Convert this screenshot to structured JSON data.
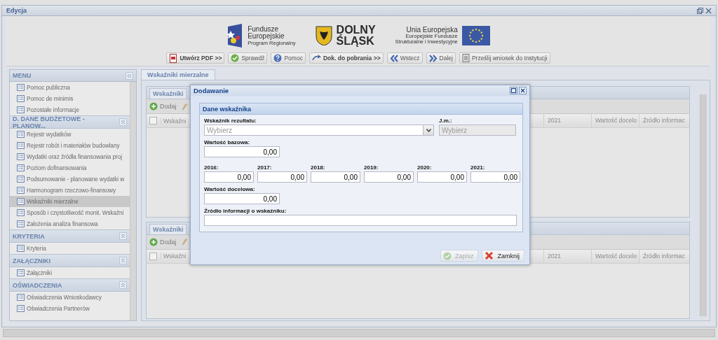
{
  "window": {
    "title": "Edycja"
  },
  "header": {
    "logos": [
      {
        "kind": "fe",
        "lines": [
          "Fundusze",
          "Europejskie",
          "Program Regionalny"
        ]
      },
      {
        "kind": "ds",
        "lines": [
          "DOLNY",
          "ŚLĄSK"
        ]
      },
      {
        "kind": "ue",
        "lines": [
          "Unia Europejska",
          "Europejskie Fundusze",
          "Strukturalne i Inwestycyjne"
        ]
      }
    ],
    "toolbar": [
      {
        "label": "Utwórz PDF >>",
        "kind": "pdf",
        "emphasis": true
      },
      {
        "label": "Sprawdź",
        "kind": "check",
        "emphasis": false
      },
      {
        "label": "Pomoc",
        "kind": "help",
        "emphasis": false
      },
      {
        "label": "Dok. do pobrania >>",
        "kind": "curl",
        "emphasis": true
      },
      {
        "label": "Wstecz",
        "kind": "back",
        "emphasis": false
      },
      {
        "label": "Dalej",
        "kind": "forward",
        "emphasis": false
      },
      {
        "label": "Prześlij wniosek do Instytucji",
        "kind": "send",
        "emphasis": false
      }
    ]
  },
  "menu": {
    "title": "MENU",
    "items": [
      {
        "label": "Pomoc publiczna",
        "selected": false
      },
      {
        "label": "Pomoc de minimis",
        "selected": false
      },
      {
        "label": "Pozostałe informacje",
        "selected": false
      }
    ],
    "sections": [
      {
        "title": "D. DANE BUDŻETOWE - PLANOW...",
        "items": [
          {
            "label": "Rejestr wydatków",
            "selected": false
          },
          {
            "label": "Rejestr robót i materiałów budowlany",
            "selected": false
          },
          {
            "label": "Wydatki oraz źródła finansowania proj",
            "selected": false
          },
          {
            "label": "Poziom dofinansowania",
            "selected": false
          },
          {
            "label": "Podsumowanie - planowane wydatki w",
            "selected": false
          },
          {
            "label": "Harmonogram rzeczowo-finansowy",
            "selected": false
          },
          {
            "label": "Wskaźniki mierzalne",
            "selected": true
          },
          {
            "label": "Sposób i częstotliwość monit. Wskaźni",
            "selected": false
          },
          {
            "label": "Założenia analiza finansowa",
            "selected": false
          }
        ]
      },
      {
        "title": "KRYTERIA",
        "items": [
          {
            "label": "Kryteria",
            "selected": false
          }
        ]
      },
      {
        "title": "ZAŁĄCZNIKI",
        "items": [
          {
            "label": "Załączniki",
            "selected": false
          }
        ]
      },
      {
        "title": "OŚWIADCZENIA",
        "items": [
          {
            "label": "Oświadczenia Wnioskodawcy",
            "selected": false
          },
          {
            "label": "Oświadczenia Partnerów",
            "selected": false
          }
        ]
      }
    ]
  },
  "main_tab": {
    "label": "Wskaźniki mierzalne",
    "selected": true
  },
  "panels": [
    {
      "tab": "Wskaźniki",
      "add_button": "Dodaj",
      "select_all_checked": false,
      "column_1": "Wskaźni",
      "right_columns": [
        "2021",
        "Wartość docelo",
        "Źródło informac"
      ]
    },
    {
      "tab": "Wskaźniki",
      "add_button": "Dodaj",
      "select_all_checked": false,
      "column_1": "Wskaźni",
      "right_columns": [
        "2021",
        "Wartość docelo",
        "Źródło informac"
      ]
    }
  ],
  "dialog": {
    "title": "Dodawanie",
    "section": "Dane wskaźnika",
    "indicator": {
      "label": "Wskaźnik rezultatu:",
      "placeholder": "Wybierz"
    },
    "unit": {
      "label": "J.m.:",
      "placeholder": "Wybierz",
      "disabled": true
    },
    "base": {
      "label": "Wartość bazowa:",
      "value": "0,00"
    },
    "years": [
      {
        "label": "2016:",
        "value": "0,00"
      },
      {
        "label": "2017:",
        "value": "0,00"
      },
      {
        "label": "2018:",
        "value": "0,00"
      },
      {
        "label": "2019:",
        "value": "0,00"
      },
      {
        "label": "2020:",
        "value": "0,00"
      },
      {
        "label": "2021:",
        "value": "0,00"
      }
    ],
    "target": {
      "label": "Wartość docelowa:",
      "value": "0,00"
    },
    "source": {
      "label": "Źródło informacji o wskaźniku:"
    },
    "buttons": [
      {
        "label": "Zapisz",
        "kind": "check",
        "disabled": true
      },
      {
        "label": "Zamknij",
        "kind": "close",
        "disabled": false
      }
    ]
  }
}
